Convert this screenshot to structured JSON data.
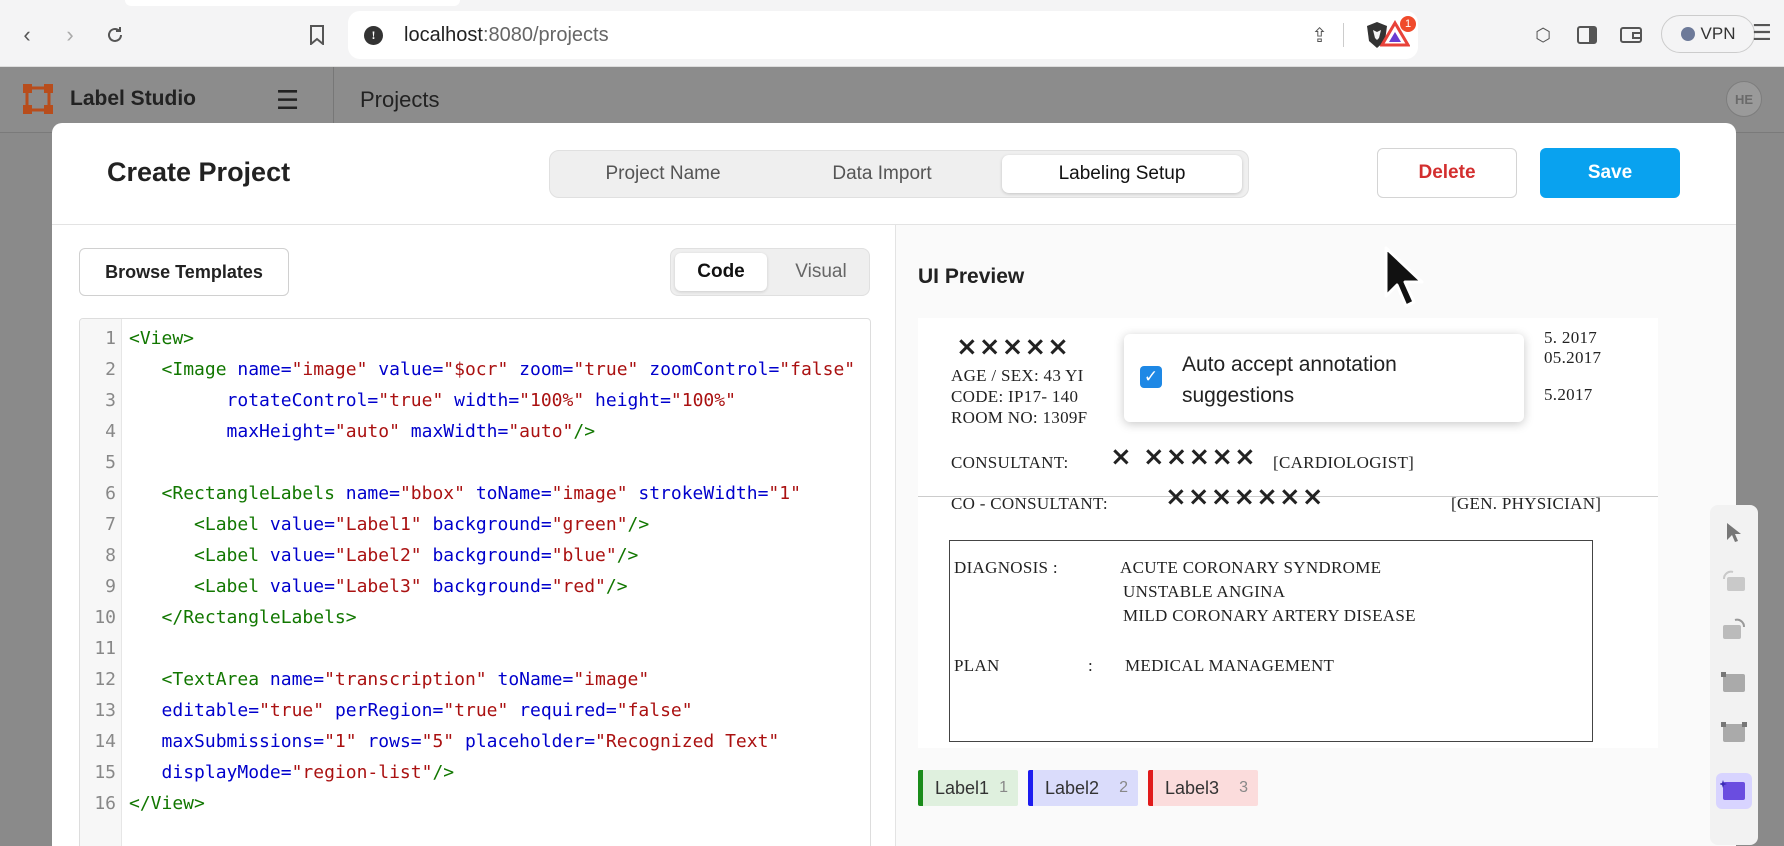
{
  "browser": {
    "url_host": "localhost",
    "url_path": ":8080/projects",
    "alert_count": "1",
    "vpn_label": "VPN"
  },
  "app": {
    "name": "Label Studio",
    "breadcrumb": "Projects",
    "avatar_initials": "HE"
  },
  "modal": {
    "title": "Create Project",
    "steps": [
      "Project Name",
      "Data Import",
      "Labeling Setup"
    ],
    "active_step": "Labeling Setup",
    "delete_label": "Delete",
    "save_label": "Save"
  },
  "left": {
    "browse_label": "Browse Templates",
    "tabs": [
      "Code",
      "Visual"
    ],
    "active_tab": "Code"
  },
  "code_lines": [
    [
      {
        "c": "tg",
        "t": "<View>"
      }
    ],
    [
      {
        "c": "",
        "t": "   "
      },
      {
        "c": "tg",
        "t": "<Image "
      },
      {
        "c": "at",
        "t": "name="
      },
      {
        "c": "st",
        "t": "\"image\""
      },
      {
        "c": "",
        "t": " "
      },
      {
        "c": "at",
        "t": "value="
      },
      {
        "c": "st",
        "t": "\"$ocr\""
      },
      {
        "c": "",
        "t": " "
      },
      {
        "c": "at",
        "t": "zoom="
      },
      {
        "c": "st",
        "t": "\"true\""
      },
      {
        "c": "",
        "t": " "
      },
      {
        "c": "at",
        "t": "zoomControl="
      },
      {
        "c": "st",
        "t": "\"false\""
      }
    ],
    [
      {
        "c": "",
        "t": "         "
      },
      {
        "c": "at",
        "t": "rotateControl="
      },
      {
        "c": "st",
        "t": "\"true\""
      },
      {
        "c": "",
        "t": " "
      },
      {
        "c": "at",
        "t": "width="
      },
      {
        "c": "st",
        "t": "\"100%\""
      },
      {
        "c": "",
        "t": " "
      },
      {
        "c": "at",
        "t": "height="
      },
      {
        "c": "st",
        "t": "\"100%\""
      }
    ],
    [
      {
        "c": "",
        "t": "         "
      },
      {
        "c": "at",
        "t": "maxHeight="
      },
      {
        "c": "st",
        "t": "\"auto\""
      },
      {
        "c": "",
        "t": " "
      },
      {
        "c": "at",
        "t": "maxWidth="
      },
      {
        "c": "st",
        "t": "\"auto\""
      },
      {
        "c": "tg",
        "t": "/>"
      }
    ],
    [],
    [
      {
        "c": "",
        "t": "   "
      },
      {
        "c": "tg",
        "t": "<RectangleLabels "
      },
      {
        "c": "at",
        "t": "name="
      },
      {
        "c": "st",
        "t": "\"bbox\""
      },
      {
        "c": "",
        "t": " "
      },
      {
        "c": "at",
        "t": "toName="
      },
      {
        "c": "st",
        "t": "\"image\""
      },
      {
        "c": "",
        "t": " "
      },
      {
        "c": "at",
        "t": "strokeWidth="
      },
      {
        "c": "st",
        "t": "\"1\""
      }
    ],
    [
      {
        "c": "",
        "t": "      "
      },
      {
        "c": "tg",
        "t": "<Label "
      },
      {
        "c": "at",
        "t": "value="
      },
      {
        "c": "st",
        "t": "\"Label1\""
      },
      {
        "c": "",
        "t": " "
      },
      {
        "c": "at",
        "t": "background="
      },
      {
        "c": "st",
        "t": "\"green\""
      },
      {
        "c": "tg",
        "t": "/>"
      }
    ],
    [
      {
        "c": "",
        "t": "      "
      },
      {
        "c": "tg",
        "t": "<Label "
      },
      {
        "c": "at",
        "t": "value="
      },
      {
        "c": "st",
        "t": "\"Label2\""
      },
      {
        "c": "",
        "t": " "
      },
      {
        "c": "at",
        "t": "background="
      },
      {
        "c": "st",
        "t": "\"blue\""
      },
      {
        "c": "tg",
        "t": "/>"
      }
    ],
    [
      {
        "c": "",
        "t": "      "
      },
      {
        "c": "tg",
        "t": "<Label "
      },
      {
        "c": "at",
        "t": "value="
      },
      {
        "c": "st",
        "t": "\"Label3\""
      },
      {
        "c": "",
        "t": " "
      },
      {
        "c": "at",
        "t": "background="
      },
      {
        "c": "st",
        "t": "\"red\""
      },
      {
        "c": "tg",
        "t": "/>"
      }
    ],
    [
      {
        "c": "",
        "t": "   "
      },
      {
        "c": "tg",
        "t": "</RectangleLabels>"
      }
    ],
    [],
    [
      {
        "c": "",
        "t": "   "
      },
      {
        "c": "tg",
        "t": "<TextArea "
      },
      {
        "c": "at",
        "t": "name="
      },
      {
        "c": "st",
        "t": "\"transcription\""
      },
      {
        "c": "",
        "t": " "
      },
      {
        "c": "at",
        "t": "toName="
      },
      {
        "c": "st",
        "t": "\"image\""
      }
    ],
    [
      {
        "c": "",
        "t": "   "
      },
      {
        "c": "at",
        "t": "editable="
      },
      {
        "c": "st",
        "t": "\"true\""
      },
      {
        "c": "",
        "t": " "
      },
      {
        "c": "at",
        "t": "perRegion="
      },
      {
        "c": "st",
        "t": "\"true\""
      },
      {
        "c": "",
        "t": " "
      },
      {
        "c": "at",
        "t": "required="
      },
      {
        "c": "st",
        "t": "\"false\""
      }
    ],
    [
      {
        "c": "",
        "t": "   "
      },
      {
        "c": "at",
        "t": "maxSubmissions="
      },
      {
        "c": "st",
        "t": "\"1\""
      },
      {
        "c": "",
        "t": " "
      },
      {
        "c": "at",
        "t": "rows="
      },
      {
        "c": "st",
        "t": "\"5\""
      },
      {
        "c": "",
        "t": " "
      },
      {
        "c": "at",
        "t": "placeholder="
      },
      {
        "c": "st",
        "t": "\"Recognized Text\""
      }
    ],
    [
      {
        "c": "",
        "t": "   "
      },
      {
        "c": "at",
        "t": "displayMode="
      },
      {
        "c": "st",
        "t": "\"region-list\""
      },
      {
        "c": "tg",
        "t": "/>"
      }
    ],
    [
      {
        "c": "tg",
        "t": "</View>"
      }
    ]
  ],
  "preview": {
    "title": "UI Preview",
    "auto_accept_text": "Auto accept annotation suggestions",
    "auto_accept_checked": true,
    "document": {
      "age_sex": "AGE / SEX: 43 YI",
      "code": "CODE: IP17- 140",
      "room": "ROOM NO: 1309F",
      "date1": "5. 2017",
      "date2": "05.2017",
      "date3": "5.2017",
      "consultant_label": "CONSULTANT:",
      "consultant_role": "[CARDIOLOGIST]",
      "co_consultant_label": "CO - CONSULTANT:",
      "co_consultant_role": "[GEN. PHYSICIAN]",
      "diagnosis_label": "DIAGNOSIS :",
      "diagnosis_1": "ACUTE CORONARY SYNDROME",
      "diagnosis_2": "UNSTABLE ANGINA",
      "diagnosis_3": "MILD CORONARY ARTERY DISEASE",
      "plan_label": "PLAN",
      "plan_colon": ":",
      "plan_value": "MEDICAL MANAGEMENT"
    },
    "labels": [
      {
        "name": "Label1",
        "key": "1",
        "color": "#1a8c1a",
        "bg": "#dff0de"
      },
      {
        "name": "Label2",
        "key": "2",
        "color": "#1c1cf0",
        "bg": "#dadcfb"
      },
      {
        "name": "Label3",
        "key": "3",
        "color": "#e11b1b",
        "bg": "#fbdcdc"
      }
    ]
  }
}
